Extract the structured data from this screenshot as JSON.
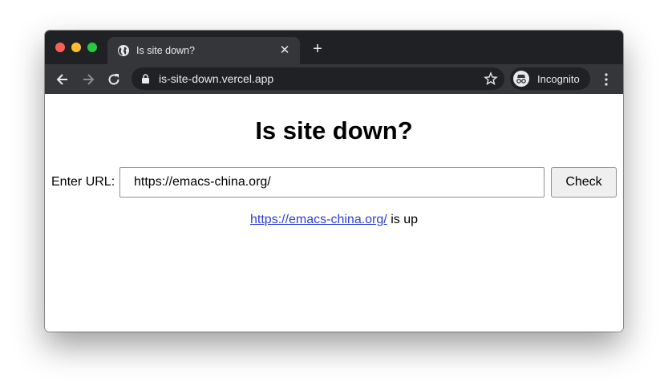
{
  "browser": {
    "tab": {
      "title": "Is site down?",
      "close_glyph": "✕",
      "favicon": "globe-icon"
    },
    "new_tab_glyph": "+",
    "address_bar": {
      "url": "is-site-down.vercel.app"
    },
    "profile": {
      "label": "Incognito"
    },
    "colors": {
      "tabbar": "#202124",
      "toolbar": "#35363a",
      "close": "#fe5f57",
      "minimize": "#febc2e",
      "zoom": "#28c840"
    }
  },
  "page": {
    "title": "Is site down?",
    "url_label": "Enter URL:",
    "url_input_value": "https://emacs-china.org/",
    "check_button": "Check",
    "result": {
      "link": "https://emacs-china.org/",
      "status": "is up"
    },
    "link_color": "#2b3fd8"
  }
}
